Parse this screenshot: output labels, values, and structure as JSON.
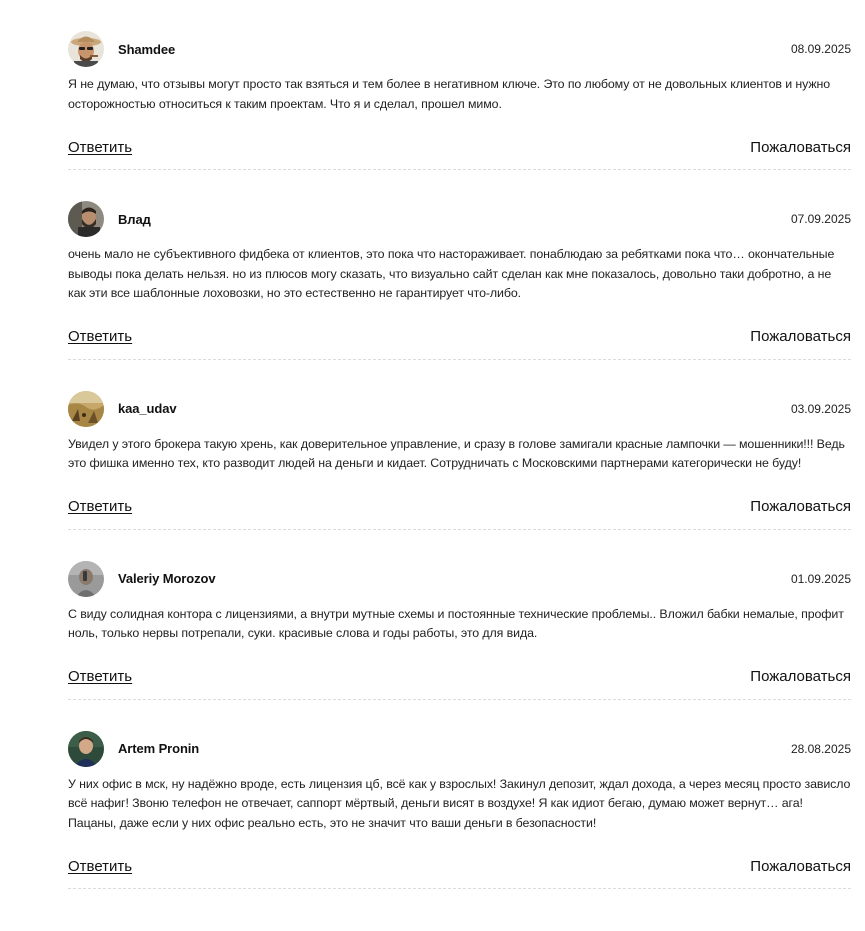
{
  "comments": [
    {
      "author": "Shamdee",
      "date": "08.09.2025",
      "avatar": "avatar-man-hat-sunglasses",
      "text": "Я не думаю, что отзывы могут просто так взяться и тем более в негативном ключе. Это по любому от не довольных клиентов и нужно осторожностью относиться к таким проектам. Что я и сделал, прошел мимо.",
      "reply_label": "Ответить",
      "report_label": "Пожаловаться"
    },
    {
      "author": "Влад",
      "date": "07.09.2025",
      "avatar": "avatar-bearded-man",
      "text": "очень мало не субъективного фидбека от клиентов, это пока что настораживает. понаблюдаю за ребятками пока что… окончательные выводы пока делать нельзя. но из плюсов могу сказать, что визуально сайт сделан как мне показалось, довольно таки добротно, а не как эти все шаблонные лоховозки, но это естественно не гарантирует что-либо.",
      "reply_label": "Ответить",
      "report_label": "Пожаловаться"
    },
    {
      "author": "kaa_udav",
      "date": "03.09.2025",
      "avatar": "avatar-autumn-field",
      "text": "Увидел у этого брокера такую хрень, как доверительное управление, и сразу в голове замигали красные лампочки — мошенники!!! Ведь это фишка именно тех, кто разводит людей на деньги и кидает. Сотрудничать с Московскими партнерами категорически не буду!",
      "reply_label": "Ответить",
      "report_label": "Пожаловаться"
    },
    {
      "author": "Valeriy Morozov",
      "date": "01.09.2025",
      "avatar": "avatar-grey-man",
      "text": "С виду солидная контора с лицензиями, а внутри мутные схемы и постоянные технические проблемы.. Вложил бабки немалые, профит ноль, только нервы потрепали, суки. красивые слова и годы работы, это для вида.",
      "reply_label": "Ответить",
      "report_label": "Пожаловаться"
    },
    {
      "author": "Artem Pronin",
      "date": "28.08.2025",
      "avatar": "avatar-young-man",
      "text": "У них офис в мск, ну надёжно вроде, есть лицензия цб, всё как у взрослых! Закинул депозит, ждал дохода, а через месяц просто зависло всё нафиг! Звоню телефон не отвечает, саппорт мёртвый, деньги висят в воздухе! Я как идиот бегаю, думаю может вернут… ага! Пацаны, даже если у них офис реально есть, это не значит что ваши деньги в безопасности!",
      "reply_label": "Ответить",
      "report_label": "Пожаловаться"
    }
  ]
}
